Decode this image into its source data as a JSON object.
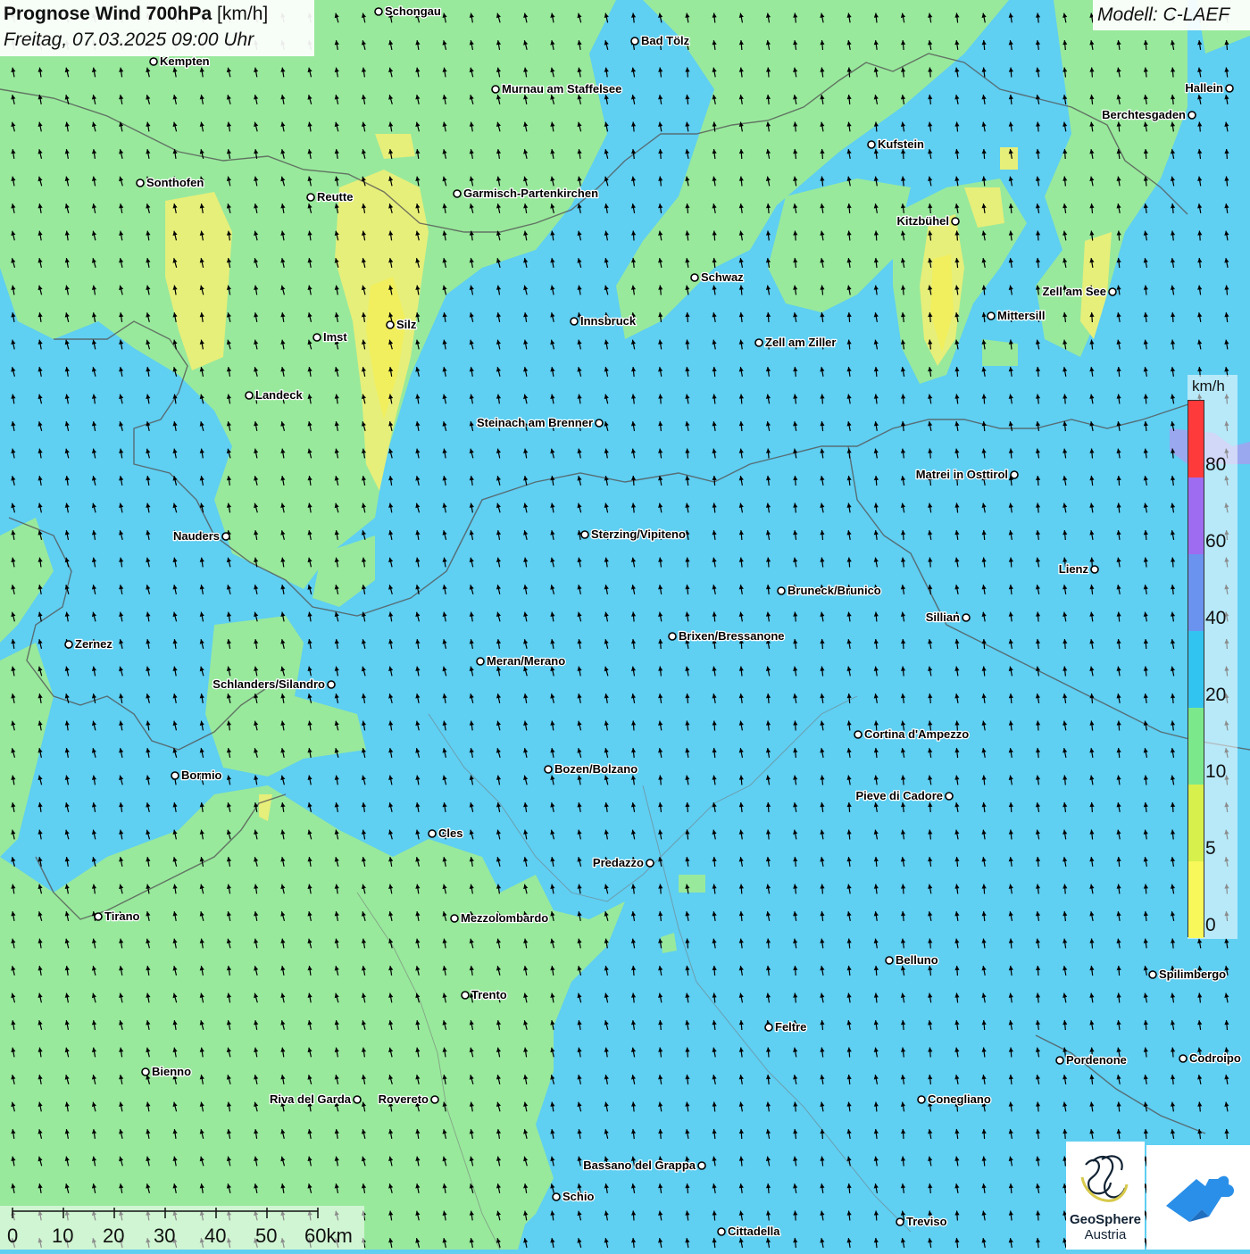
{
  "title": {
    "main": "Prognose Wind 700hPa",
    "unit": "[km/h]",
    "date": "Freitag, 07.03.2025 09:00 Uhr"
  },
  "model": "Modell: C-LAEF",
  "legend": {
    "unit": "km/h",
    "labels": [
      "80",
      "60",
      "40",
      "20",
      "10",
      "5",
      "0"
    ],
    "colors": [
      "#ff3a3a",
      "#9e6cf0",
      "#6a93f0",
      "#32c4f0",
      "#7ce88c",
      "#d8f04c",
      "#f8f85a"
    ]
  },
  "scale": {
    "labels": [
      "0",
      "10",
      "20",
      "30",
      "40",
      "50",
      "60km"
    ]
  },
  "cities": [
    {
      "name": "Schongau"
    },
    {
      "name": "Bad Tölz"
    },
    {
      "name": "Kempten"
    },
    {
      "name": "Murnau am Staffelsee"
    },
    {
      "name": "Hallein"
    },
    {
      "name": "Berchtesgaden"
    },
    {
      "name": "Kufstein"
    },
    {
      "name": "Sonthofen"
    },
    {
      "name": "Reutte"
    },
    {
      "name": "Garmisch-Partenkirchen"
    },
    {
      "name": "Kitzbühel"
    },
    {
      "name": "Schwaz"
    },
    {
      "name": "Zell am See"
    },
    {
      "name": "Silz"
    },
    {
      "name": "Imst"
    },
    {
      "name": "Innsbruck"
    },
    {
      "name": "Mittersill"
    },
    {
      "name": "Zell am Ziller"
    },
    {
      "name": "Landeck"
    },
    {
      "name": "Steinach am Brenner"
    },
    {
      "name": "Matrei in Osttirol"
    },
    {
      "name": "Nauders"
    },
    {
      "name": "Sterzing/Vipiteno"
    },
    {
      "name": "Lienz"
    },
    {
      "name": "Bruneck/Brunico"
    },
    {
      "name": "Sillian"
    },
    {
      "name": "Brixen/Bressanone"
    },
    {
      "name": "Zernez"
    },
    {
      "name": "Meran/Merano"
    },
    {
      "name": "Schlanders/Silandro"
    },
    {
      "name": "Cortina d'Ampezzo"
    },
    {
      "name": "Bozen/Bolzano"
    },
    {
      "name": "Bormio"
    },
    {
      "name": "Pieve di Cadore"
    },
    {
      "name": "Cles"
    },
    {
      "name": "Predazzo"
    },
    {
      "name": "Tirano"
    },
    {
      "name": "Mezzolombardo"
    },
    {
      "name": "Belluno"
    },
    {
      "name": "Spilimbergo"
    },
    {
      "name": "Trento"
    },
    {
      "name": "Feltre"
    },
    {
      "name": "Bienno"
    },
    {
      "name": "Pordenone"
    },
    {
      "name": "Codroipo"
    },
    {
      "name": "Riva del Garda"
    },
    {
      "name": "Rovereto"
    },
    {
      "name": "Conegliano"
    },
    {
      "name": "Bassano del Grappa"
    },
    {
      "name": "Schio"
    },
    {
      "name": "Treviso"
    },
    {
      "name": "Cittadella"
    }
  ],
  "logo": {
    "line1": "GeoSphere",
    "line2": "Austria"
  }
}
